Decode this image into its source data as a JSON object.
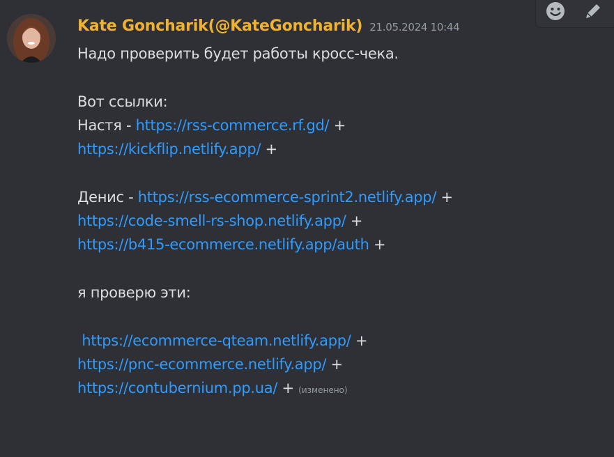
{
  "message": {
    "author": "Kate Goncharik(@KateGoncharik)",
    "timestamp": "21.05.2024 10:44",
    "edited_label": "(изменено)",
    "lines": {
      "l0": "Надо проверить будет работы кросс-чека.",
      "l2": "Вот ссылки:",
      "l3_prefix": "Настя - ",
      "l3_link": "https://rss-commerce.rf.gd/",
      "l3_suffix": " +",
      "l4_link": "https://kickflip.netlify.app/",
      "l4_suffix": " +",
      "l6_prefix": "Денис - ",
      "l6_link": "https://rss-ecommerce-sprint2.netlify.app/",
      "l6_suffix": " +",
      "l7_link": "https://code-smell-rs-shop.netlify.app/",
      "l7_suffix": " +",
      "l8_link": "https://b415-ecommerce.netlify.app/auth",
      "l8_suffix": " +",
      "l10": "я проверю эти:",
      "l12_link": "https://ecommerce-qteam.netlify.app/",
      "l12_suffix": " +",
      "l13_link": "https://pnc-ecommerce.netlify.app/",
      "l13_suffix": " +",
      "l14_link": "https://contubernium.pp.ua/",
      "l14_suffix": " + "
    }
  },
  "toolbar": {
    "icons": [
      "emoji-icon",
      "pencil-icon"
    ]
  },
  "colors": {
    "background": "#2e3035",
    "author": "#f0b232",
    "link": "#2f9bff",
    "text": "#dbdee1",
    "muted": "#949ba4"
  }
}
